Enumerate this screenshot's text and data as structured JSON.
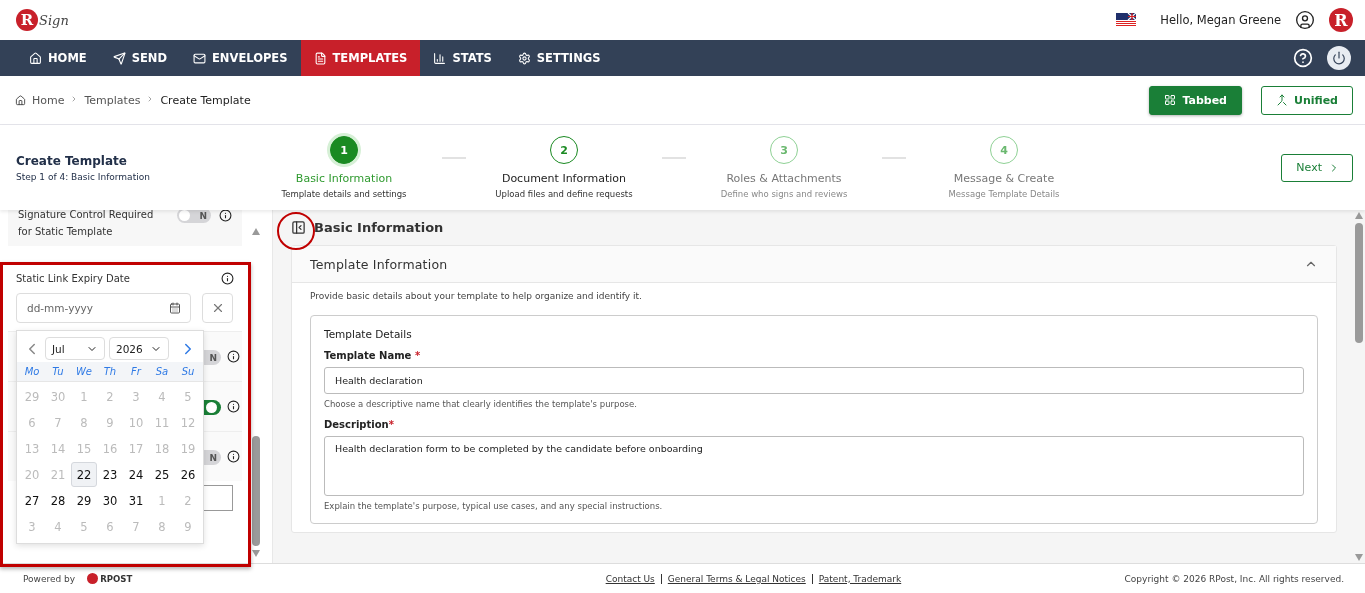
{
  "header": {
    "logo_letter": "R",
    "logo_text": "Sign",
    "greeting": "Hello, Megan Greene",
    "avatar_letter": "R"
  },
  "nav": {
    "items": [
      {
        "label": "HOME",
        "selected": false
      },
      {
        "label": "SEND",
        "selected": false
      },
      {
        "label": "ENVELOPES",
        "selected": false
      },
      {
        "label": "TEMPLATES",
        "selected": true
      },
      {
        "label": "STATS",
        "selected": false
      },
      {
        "label": "SETTINGS",
        "selected": false
      }
    ]
  },
  "breadcrumb": [
    "Home",
    "Templates",
    "Create Template"
  ],
  "view_buttons": [
    {
      "label": "Tabbed",
      "selected": true
    },
    {
      "label": "Unified",
      "selected": false
    }
  ],
  "page": {
    "title": "Create Template",
    "subtitle": "Step 1 of 4: Basic Information"
  },
  "steps": [
    {
      "number": "1",
      "title": "Basic Information",
      "subtitle": "Template details and settings",
      "selected": true,
      "disabled": false
    },
    {
      "number": "2",
      "title": "Document Information",
      "subtitle": "Upload files and define requests",
      "selected": false,
      "disabled": false
    },
    {
      "number": "3",
      "title": "Roles & Attachments",
      "subtitle": "Define who signs and reviews",
      "selected": false,
      "disabled": true
    },
    {
      "number": "4",
      "title": "Message & Create",
      "subtitle": "Message Template Details",
      "selected": false,
      "disabled": true
    }
  ],
  "next_button": "Next",
  "sidebar": {
    "first_setting": {
      "label": "Signature Control Required for Static Template",
      "toggle_text": "N",
      "on": false
    },
    "expiry": {
      "label": "Static Link Expiry Date",
      "placeholder": "dd-mm-yyyy"
    },
    "hidden_rows": [
      {
        "kind": "toggle",
        "toggle_text": "N",
        "on": false
      },
      {
        "kind": "toggle",
        "on": true
      },
      {
        "kind": "toggle",
        "toggle_text": "N",
        "on": false
      },
      {
        "kind": "input"
      }
    ]
  },
  "calendar": {
    "month": "Jul",
    "year": "2026",
    "weekdays": [
      "Mo",
      "Tu",
      "We",
      "Th",
      "Fr",
      "Sa",
      "Su"
    ],
    "days": [
      {
        "d": "29",
        "disabled": true,
        "selected": false
      },
      {
        "d": "30",
        "disabled": true,
        "selected": false
      },
      {
        "d": "1",
        "disabled": true,
        "selected": false
      },
      {
        "d": "2",
        "disabled": true,
        "selected": false
      },
      {
        "d": "3",
        "disabled": true,
        "selected": false
      },
      {
        "d": "4",
        "disabled": true,
        "selected": false
      },
      {
        "d": "5",
        "disabled": true,
        "selected": false
      },
      {
        "d": "6",
        "disabled": true,
        "selected": false
      },
      {
        "d": "7",
        "disabled": true,
        "selected": false
      },
      {
        "d": "8",
        "disabled": true,
        "selected": false
      },
      {
        "d": "9",
        "disabled": true,
        "selected": false
      },
      {
        "d": "10",
        "disabled": true,
        "selected": false
      },
      {
        "d": "11",
        "disabled": true,
        "selected": false
      },
      {
        "d": "12",
        "disabled": true,
        "selected": false
      },
      {
        "d": "13",
        "disabled": true,
        "selected": false
      },
      {
        "d": "14",
        "disabled": true,
        "selected": false
      },
      {
        "d": "15",
        "disabled": true,
        "selected": false
      },
      {
        "d": "16",
        "disabled": true,
        "selected": false
      },
      {
        "d": "17",
        "disabled": true,
        "selected": false
      },
      {
        "d": "18",
        "disabled": true,
        "selected": false
      },
      {
        "d": "19",
        "disabled": true,
        "selected": false
      },
      {
        "d": "20",
        "disabled": true,
        "selected": false
      },
      {
        "d": "21",
        "disabled": true,
        "selected": false
      },
      {
        "d": "22",
        "disabled": false,
        "selected": true
      },
      {
        "d": "23",
        "disabled": false,
        "selected": false
      },
      {
        "d": "24",
        "disabled": false,
        "selected": false
      },
      {
        "d": "25",
        "disabled": false,
        "selected": false
      },
      {
        "d": "26",
        "disabled": false,
        "selected": false
      },
      {
        "d": "27",
        "disabled": false,
        "selected": false
      },
      {
        "d": "28",
        "disabled": false,
        "selected": false
      },
      {
        "d": "29",
        "disabled": false,
        "selected": false
      },
      {
        "d": "30",
        "disabled": false,
        "selected": false
      },
      {
        "d": "31",
        "disabled": false,
        "selected": false
      },
      {
        "d": "1",
        "disabled": true,
        "selected": false
      },
      {
        "d": "2",
        "disabled": true,
        "selected": false
      },
      {
        "d": "3",
        "disabled": true,
        "selected": false
      },
      {
        "d": "4",
        "disabled": true,
        "selected": false
      },
      {
        "d": "5",
        "disabled": true,
        "selected": false
      },
      {
        "d": "6",
        "disabled": true,
        "selected": false
      },
      {
        "d": "7",
        "disabled": true,
        "selected": false
      },
      {
        "d": "8",
        "disabled": true,
        "selected": false
      },
      {
        "d": "9",
        "disabled": true,
        "selected": false
      }
    ]
  },
  "main": {
    "title": "Basic Information",
    "section": {
      "title": "Template Information",
      "expanded": true,
      "intro": "Provide basic details about your template to help organize and identify it.",
      "card_title": "Template Details",
      "fields": [
        {
          "kind": "input",
          "label": "Template Name",
          "required": "*",
          "value": "Health declaration",
          "hint": "Choose a descriptive name that clearly identifies the template's purpose."
        },
        {
          "kind": "textarea",
          "label": "Description",
          "required": "*",
          "value": "Health declaration form to be completed by the candidate before onboarding",
          "hint": "Explain the template's purpose, typical use cases, and any special instructions."
        }
      ]
    }
  },
  "footer": {
    "powered_by": "Powered by",
    "brand": "RPOST",
    "links": [
      "Contact Us",
      "General Terms & Legal Notices",
      "Patent, Trademark"
    ],
    "copyright": "Copyright © 2026 RPost, Inc. All rights reserved."
  }
}
